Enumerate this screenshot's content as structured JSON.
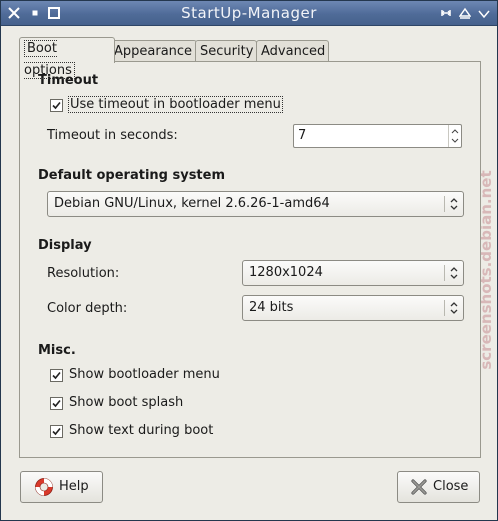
{
  "window": {
    "title": "StartUp-Manager"
  },
  "tabs": [
    {
      "label": "Boot options"
    },
    {
      "label": "Appearance"
    },
    {
      "label": "Security"
    },
    {
      "label": "Advanced"
    }
  ],
  "timeout": {
    "heading": "Timeout",
    "use_timeout_label": "Use timeout in bootloader menu",
    "use_timeout_checked": true,
    "seconds_label": "Timeout in seconds:",
    "seconds_value": "7"
  },
  "default_os": {
    "heading": "Default operating system",
    "selected": "Debian GNU/Linux, kernel 2.6.26-1-amd64"
  },
  "display": {
    "heading": "Display",
    "resolution_label": "Resolution:",
    "resolution_value": "1280x1024",
    "color_depth_label": "Color depth:",
    "color_depth_value": "24 bits"
  },
  "misc": {
    "heading": "Misc.",
    "items": [
      {
        "label": "Show bootloader menu",
        "checked": true
      },
      {
        "label": "Show boot splash",
        "checked": true
      },
      {
        "label": "Show text during boot",
        "checked": true
      }
    ]
  },
  "buttons": {
    "help": "Help",
    "close": "Close"
  },
  "watermark": "screenshots.debian.net",
  "colors": {
    "titlebar": "#4f6b98",
    "window_bg": "#edece6"
  }
}
